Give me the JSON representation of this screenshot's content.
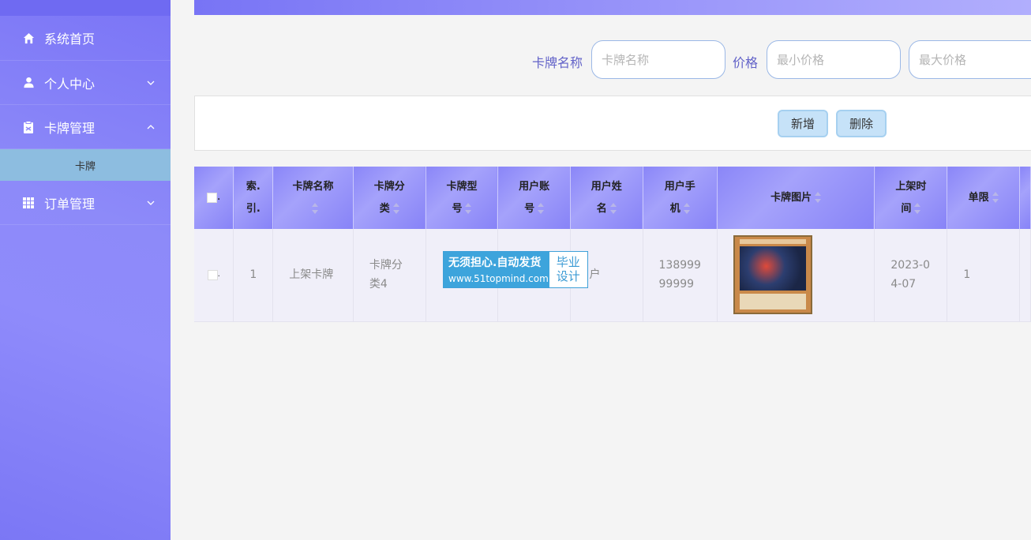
{
  "sidebar": {
    "items": [
      {
        "label": "系统首页",
        "icon": "home-icon"
      },
      {
        "label": "个人中心",
        "icon": "user-icon"
      },
      {
        "label": "卡牌管理",
        "icon": "clipboard-icon"
      },
      {
        "label": "订单管理",
        "icon": "grid-icon"
      }
    ],
    "submenu": {
      "label": "卡牌"
    }
  },
  "search": {
    "name_label": "卡牌名称",
    "name_placeholder": "卡牌名称",
    "price_label": "价格",
    "min_placeholder": "最小价格",
    "max_placeholder": "最大价格"
  },
  "actions": {
    "add_label": "新增",
    "delete_label": "删除"
  },
  "table": {
    "headers": {
      "index": "索.\n引.",
      "name": "卡牌名称",
      "category": "卡牌分\n类",
      "model": "卡牌型\n号",
      "account": "用户账\n号",
      "username": "用户姓\n名",
      "phone": "用户手\n机",
      "image": "卡牌图片",
      "time": "上架时\n间",
      "limit": "单限"
    },
    "rows": [
      {
        "index": "1",
        "name": "上架卡牌",
        "category": "卡牌分\n类4",
        "model": "",
        "account": "",
        "username": "A用户",
        "phone": "138999\n99999",
        "time": "2023-0\n4-07",
        "limit": "1"
      }
    ]
  },
  "watermark": {
    "line1": "无须担心.自动发货",
    "line2": "www.51topmind.com",
    "right": "毕业\n设计"
  }
}
